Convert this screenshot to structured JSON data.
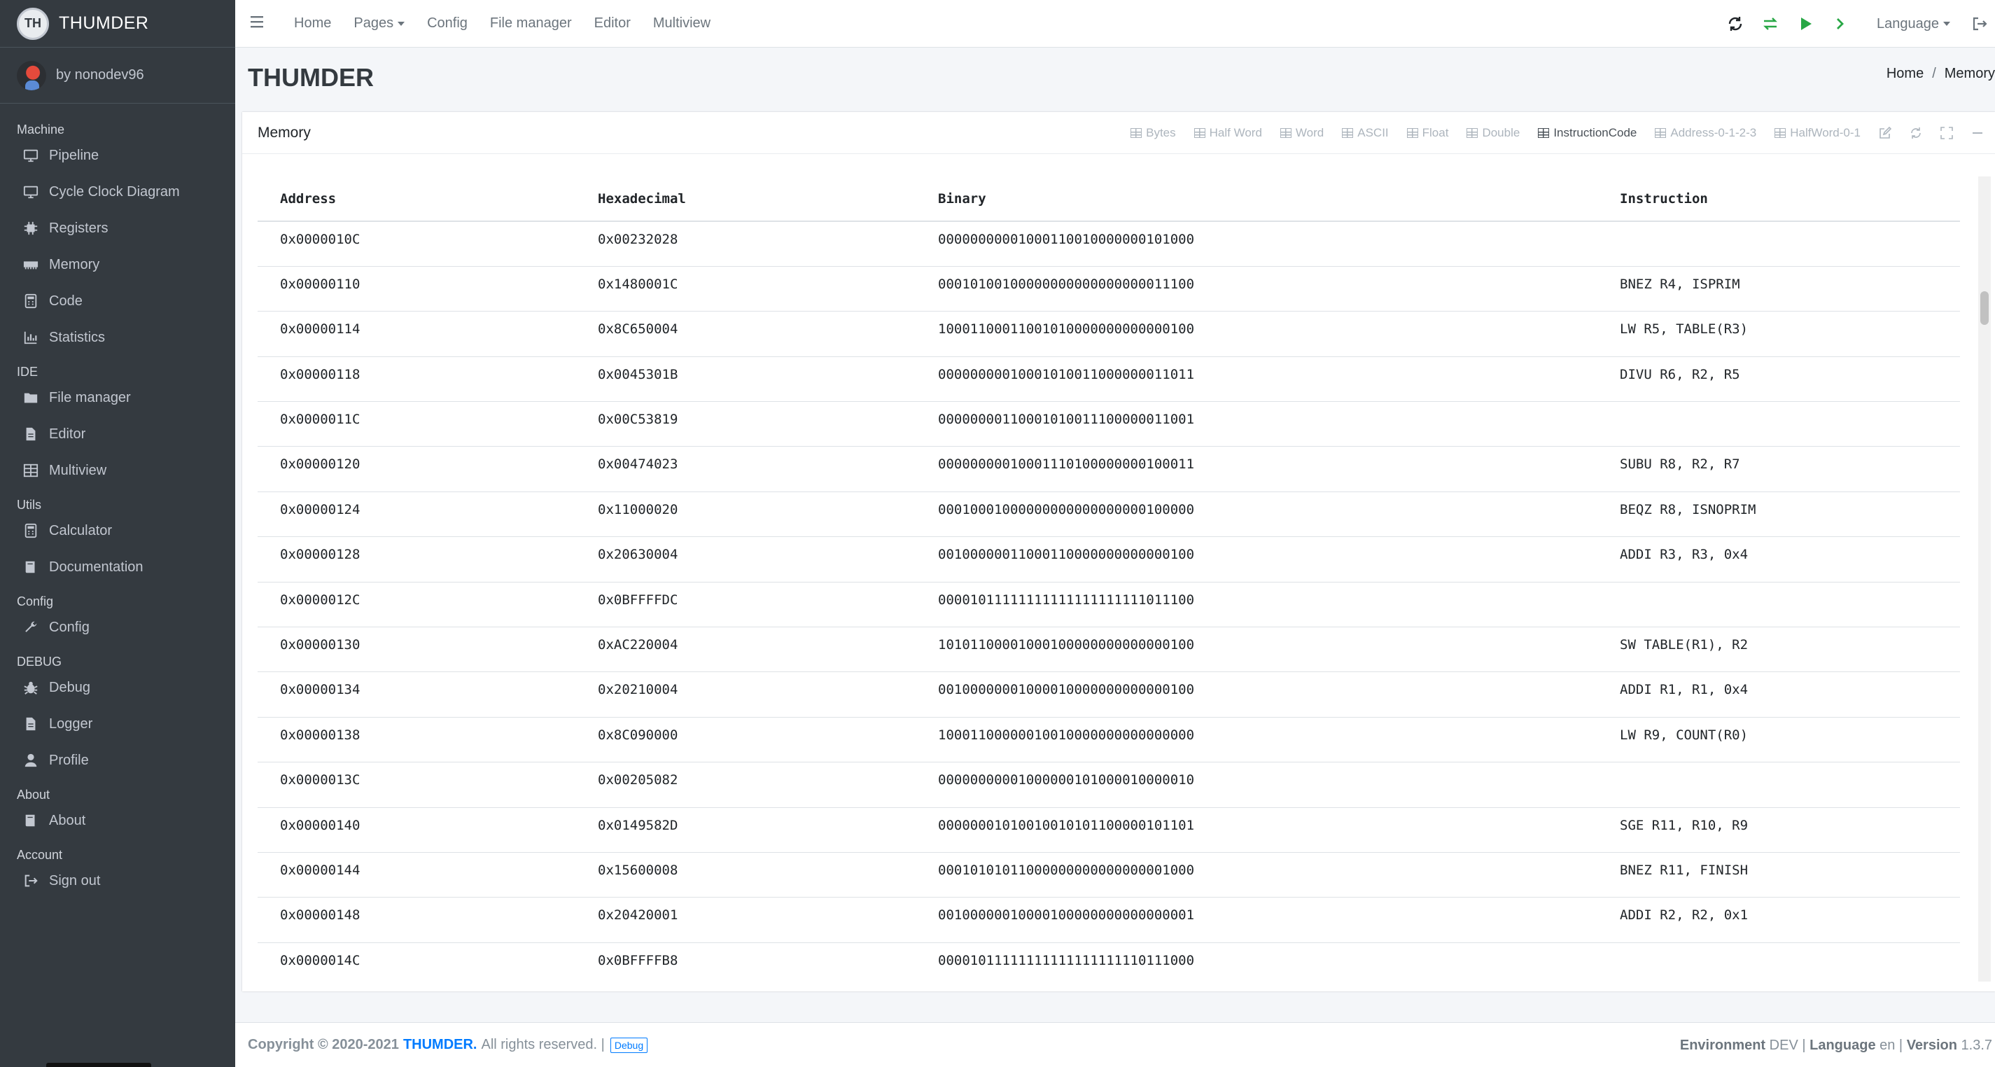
{
  "brand": {
    "name": "THUMDER",
    "logo_text": "TH"
  },
  "user": {
    "name": "by nonodev96"
  },
  "sidebar": {
    "sections": [
      {
        "header": "Machine",
        "items": [
          {
            "label": "Pipeline",
            "icon": "desktop-icon"
          },
          {
            "label": "Cycle Clock Diagram",
            "icon": "desktop-icon"
          },
          {
            "label": "Registers",
            "icon": "chip-icon"
          },
          {
            "label": "Memory",
            "icon": "memory-icon"
          },
          {
            "label": "Code",
            "icon": "calculator-icon"
          },
          {
            "label": "Statistics",
            "icon": "chart-icon"
          }
        ]
      },
      {
        "header": "IDE",
        "items": [
          {
            "label": "File manager",
            "icon": "folder-icon"
          },
          {
            "label": "Editor",
            "icon": "file-icon"
          },
          {
            "label": "Multiview",
            "icon": "table-icon"
          }
        ]
      },
      {
        "header": "Utils",
        "items": [
          {
            "label": "Calculator",
            "icon": "calculator-icon"
          },
          {
            "label": "Documentation",
            "icon": "book-icon"
          }
        ]
      },
      {
        "header": "Config",
        "items": [
          {
            "label": "Config",
            "icon": "wrench-icon"
          }
        ]
      },
      {
        "header": "DEBUG",
        "items": [
          {
            "label": "Debug",
            "icon": "bug-icon"
          },
          {
            "label": "Logger",
            "icon": "file-icon"
          },
          {
            "label": "Profile",
            "icon": "user-icon"
          }
        ]
      },
      {
        "header": "About",
        "items": [
          {
            "label": "About",
            "icon": "book-icon"
          }
        ]
      },
      {
        "header": "Account",
        "items": [
          {
            "label": "Sign out",
            "icon": "sign-out-icon"
          }
        ]
      }
    ]
  },
  "navbar": {
    "links": [
      "Home",
      "Pages",
      "Config",
      "File manager",
      "Editor",
      "Multiview"
    ],
    "language": "Language",
    "colors": {
      "green": "#28a745",
      "muted": "#6c757d"
    }
  },
  "header": {
    "title": "THUMDER",
    "breadcrumb": [
      "Home",
      "Memory"
    ]
  },
  "card": {
    "title": "Memory",
    "tools": [
      "Bytes",
      "Half Word",
      "Word",
      "ASCII",
      "Float",
      "Double",
      "InstructionCode",
      "Address-0-1-2-3",
      "HalfWord-0-1"
    ],
    "active_tool": "InstructionCode"
  },
  "table": {
    "columns": [
      "Address",
      "Hexadecimal",
      "Binary",
      "Instruction"
    ],
    "rows": [
      [
        "0x0000010C",
        "0x00232028",
        "00000000001000110010000000101000",
        ""
      ],
      [
        "0x00000110",
        "0x1480001C",
        "00010100100000000000000000011100",
        "BNEZ R4, ISPRIM"
      ],
      [
        "0x00000114",
        "0x8C650004",
        "10001100011001010000000000000100",
        "LW R5, TABLE(R3)"
      ],
      [
        "0x00000118",
        "0x0045301B",
        "00000000010001010011000000011011",
        "DIVU R6, R2, R5"
      ],
      [
        "0x0000011C",
        "0x00C53819",
        "00000000110001010011100000011001",
        ""
      ],
      [
        "0x00000120",
        "0x00474023",
        "00000000010001110100000000100011",
        "SUBU R8, R2, R7"
      ],
      [
        "0x00000124",
        "0x11000020",
        "00010001000000000000000000100000",
        "BEQZ R8, ISNOPRIM"
      ],
      [
        "0x00000128",
        "0x20630004",
        "00100000011000110000000000000100",
        "ADDI R3, R3, 0x4"
      ],
      [
        "0x0000012C",
        "0x0BFFFFDC",
        "00001011111111111111111111011100",
        ""
      ],
      [
        "0x00000130",
        "0xAC220004",
        "10101100001000100000000000000100",
        "SW TABLE(R1), R2"
      ],
      [
        "0x00000134",
        "0x20210004",
        "00100000001000010000000000000100",
        "ADDI R1, R1, 0x4"
      ],
      [
        "0x00000138",
        "0x8C090000",
        "10001100000010010000000000000000",
        "LW R9, COUNT(R0)"
      ],
      [
        "0x0000013C",
        "0x00205082",
        "00000000001000000101000010000010",
        ""
      ],
      [
        "0x00000140",
        "0x0149582D",
        "00000001010010010101100000101101",
        "SGE R11, R10, R9"
      ],
      [
        "0x00000144",
        "0x15600008",
        "00010101011000000000000000001000",
        "BNEZ R11, FINISH"
      ],
      [
        "0x00000148",
        "0x20420001",
        "00100000010000100000000000000001",
        "ADDI R2, R2, 0x1"
      ],
      [
        "0x0000014C",
        "0x0BFFFFB8",
        "00001011111111111111111110111000",
        ""
      ]
    ]
  },
  "footer": {
    "copyright": "Copyright © 2020-2021",
    "brand": "THUMDER.",
    "rights": "All rights reserved. |",
    "badge": "Debug",
    "env_label": "Environment",
    "env_value": "DEV",
    "lang_label": "Language",
    "lang_value": "en",
    "version_label": "Version",
    "version_value": "1.3.7"
  }
}
